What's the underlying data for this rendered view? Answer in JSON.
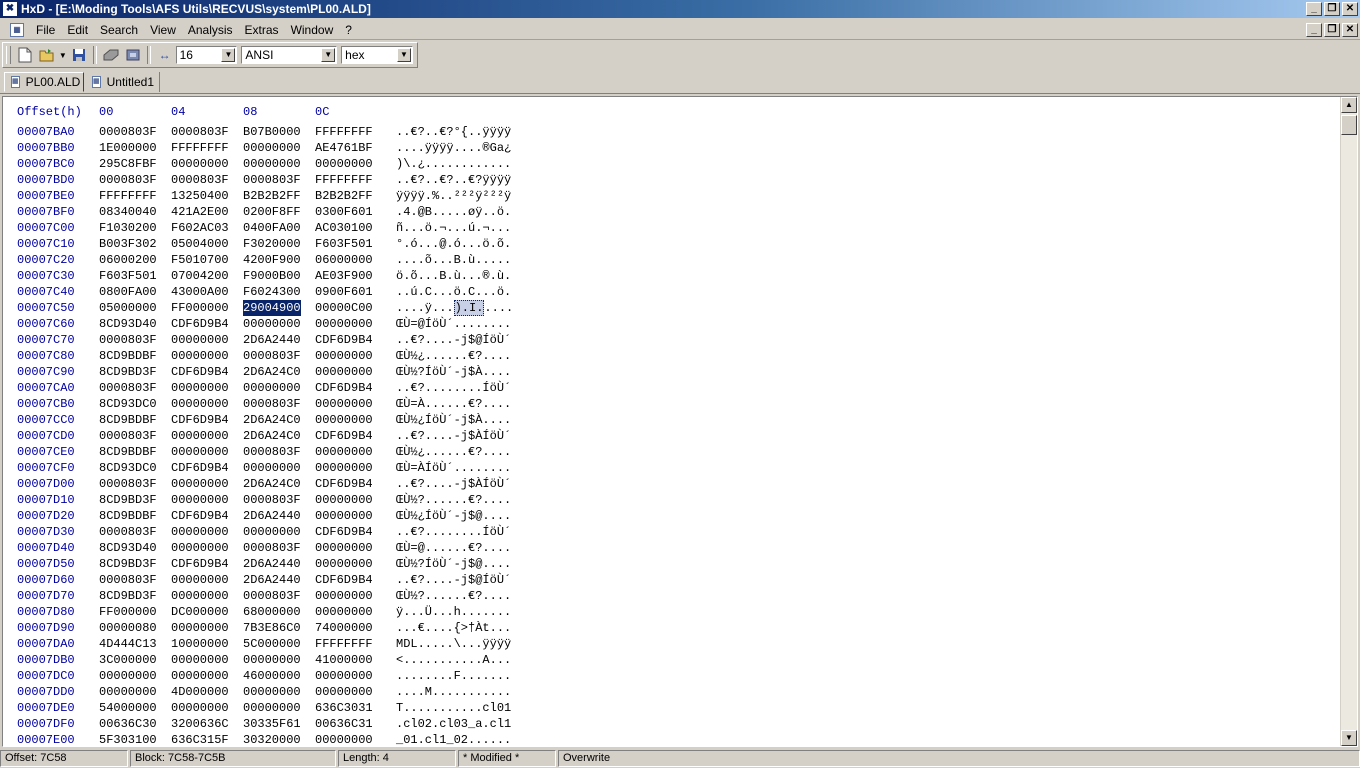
{
  "window": {
    "title": "HxD - [E:\\Moding Tools\\AFS Utils\\RECVUS\\system\\PL00.ALD]",
    "app_icon": "hxd-app-icon",
    "controls": [
      "minimize-icon",
      "restore-icon",
      "close-icon"
    ]
  },
  "menu": {
    "items": [
      "File",
      "Edit",
      "Search",
      "View",
      "Analysis",
      "Extras",
      "Window",
      "?"
    ]
  },
  "toolbar": {
    "bytes_per_row": "16",
    "charset": "ANSI",
    "offset_base": "hex",
    "icons": [
      "new-file-icon",
      "open-file-icon",
      "save-icon",
      "open-disk-icon",
      "open-ram-icon",
      "bytes-per-row-icon"
    ]
  },
  "tabs": [
    {
      "label": "PL00.ALD",
      "active": true
    },
    {
      "label": "Untitled1",
      "active": false
    }
  ],
  "hex_header": {
    "offset": "Offset(h)",
    "cols": [
      "00",
      "04",
      "08",
      "0C"
    ]
  },
  "rows": [
    {
      "o": "00007BA0",
      "h": [
        "0000803F",
        "0000803F",
        "B07B0000",
        "FFFFFFFF"
      ],
      "t": "..€?..€?°{..ÿÿÿÿ"
    },
    {
      "o": "00007BB0",
      "h": [
        "1E000000",
        "FFFFFFFF",
        "00000000",
        "AE4761BF"
      ],
      "t": "....ÿÿÿÿ....®Ga¿"
    },
    {
      "o": "00007BC0",
      "h": [
        "295C8FBF",
        "00000000",
        "00000000",
        "00000000"
      ],
      "t": ")\\.¿............"
    },
    {
      "o": "00007BD0",
      "h": [
        "0000803F",
        "0000803F",
        "0000803F",
        "FFFFFFFF"
      ],
      "t": "..€?..€?..€?ÿÿÿÿ"
    },
    {
      "o": "00007BE0",
      "h": [
        "FFFFFFFF",
        "13250400",
        "B2B2B2FF",
        "B2B2B2FF"
      ],
      "t": "ÿÿÿÿ.%..²²²ÿ²²²ÿ"
    },
    {
      "o": "00007BF0",
      "h": [
        "08340040",
        "421A2E00",
        "0200F8FF",
        "0300F601"
      ],
      "t": ".4.@B.....øÿ..ö."
    },
    {
      "o": "00007C00",
      "h": [
        "F1030200",
        "F602AC03",
        "0400FA00",
        "AC030100"
      ],
      "t": "ñ...ö.¬...ú.¬..."
    },
    {
      "o": "00007C10",
      "h": [
        "B003F302",
        "05004000",
        "F3020000",
        "F603F501"
      ],
      "t": "°.ó...@.ó...ö.õ."
    },
    {
      "o": "00007C20",
      "h": [
        "06000200",
        "F5010700",
        "4200F900",
        "06000000"
      ],
      "t": "....õ...B.ù....."
    },
    {
      "o": "00007C30",
      "h": [
        "F603F501",
        "07004200",
        "F9000B00",
        "AE03F900"
      ],
      "t": "ö.õ...B.ù...®.ù."
    },
    {
      "o": "00007C40",
      "h": [
        "0800FA00",
        "43000A00",
        "F6024300",
        "0900F601"
      ],
      "t": "..ú.C...ö.C...ö."
    },
    {
      "o": "00007C50",
      "h": [
        "05000000",
        "FF000000",
        "29004900",
        "00000C00"
      ],
      "t": "....ÿ...).I....."
    },
    {
      "o": "00007C60",
      "h": [
        "8CD93D40",
        "CDF6D9B4",
        "00000000",
        "00000000"
      ],
      "t": "ŒÙ=@ÍöÙ´........"
    },
    {
      "o": "00007C70",
      "h": [
        "0000803F",
        "00000000",
        "2D6A2440",
        "CDF6D9B4"
      ],
      "t": "..€?....-j$@ÍöÙ´"
    },
    {
      "o": "00007C80",
      "h": [
        "8CD9BDBF",
        "00000000",
        "0000803F",
        "00000000"
      ],
      "t": "ŒÙ½¿......€?...."
    },
    {
      "o": "00007C90",
      "h": [
        "8CD9BD3F",
        "CDF6D9B4",
        "2D6A24C0",
        "00000000"
      ],
      "t": "ŒÙ½?ÍöÙ´-j$À...."
    },
    {
      "o": "00007CA0",
      "h": [
        "0000803F",
        "00000000",
        "00000000",
        "CDF6D9B4"
      ],
      "t": "..€?........ÍöÙ´"
    },
    {
      "o": "00007CB0",
      "h": [
        "8CD93DC0",
        "00000000",
        "0000803F",
        "00000000"
      ],
      "t": "ŒÙ=À......€?...."
    },
    {
      "o": "00007CC0",
      "h": [
        "8CD9BDBF",
        "CDF6D9B4",
        "2D6A24C0",
        "00000000"
      ],
      "t": "ŒÙ½¿ÍöÙ´-j$À...."
    },
    {
      "o": "00007CD0",
      "h": [
        "0000803F",
        "00000000",
        "2D6A24C0",
        "CDF6D9B4"
      ],
      "t": "..€?....-j$ÀÍöÙ´"
    },
    {
      "o": "00007CE0",
      "h": [
        "8CD9BDBF",
        "00000000",
        "0000803F",
        "00000000"
      ],
      "t": "ŒÙ½¿......€?...."
    },
    {
      "o": "00007CF0",
      "h": [
        "8CD93DC0",
        "CDF6D9B4",
        "00000000",
        "00000000"
      ],
      "t": "ŒÙ=ÀÍöÙ´........"
    },
    {
      "o": "00007D00",
      "h": [
        "0000803F",
        "00000000",
        "2D6A24C0",
        "CDF6D9B4"
      ],
      "t": "..€?....-j$ÀÍöÙ´"
    },
    {
      "o": "00007D10",
      "h": [
        "8CD9BD3F",
        "00000000",
        "0000803F",
        "00000000"
      ],
      "t": "ŒÙ½?......€?...."
    },
    {
      "o": "00007D20",
      "h": [
        "8CD9BDBF",
        "CDF6D9B4",
        "2D6A2440",
        "00000000"
      ],
      "t": "ŒÙ½¿ÍöÙ´-j$@...."
    },
    {
      "o": "00007D30",
      "h": [
        "0000803F",
        "00000000",
        "00000000",
        "CDF6D9B4"
      ],
      "t": "..€?........ÍöÙ´"
    },
    {
      "o": "00007D40",
      "h": [
        "8CD93D40",
        "00000000",
        "0000803F",
        "00000000"
      ],
      "t": "ŒÙ=@......€?...."
    },
    {
      "o": "00007D50",
      "h": [
        "8CD9BD3F",
        "CDF6D9B4",
        "2D6A2440",
        "00000000"
      ],
      "t": "ŒÙ½?ÍöÙ´-j$@...."
    },
    {
      "o": "00007D60",
      "h": [
        "0000803F",
        "00000000",
        "2D6A2440",
        "CDF6D9B4"
      ],
      "t": "..€?....-j$@ÍöÙ´"
    },
    {
      "o": "00007D70",
      "h": [
        "8CD9BD3F",
        "00000000",
        "0000803F",
        "00000000"
      ],
      "t": "ŒÙ½?......€?...."
    },
    {
      "o": "00007D80",
      "h": [
        "FF000000",
        "DC000000",
        "68000000",
        "00000000"
      ],
      "t": "ÿ...Ü...h......."
    },
    {
      "o": "00007D90",
      "h": [
        "00000080",
        "00000000",
        "7B3E86C0",
        "74000000"
      ],
      "t": "...€....{>†Àt..."
    },
    {
      "o": "00007DA0",
      "h": [
        "4D444C13",
        "10000000",
        "5C000000",
        "FFFFFFFF"
      ],
      "t": "MDL.....\\...ÿÿÿÿ"
    },
    {
      "o": "00007DB0",
      "h": [
        "3C000000",
        "00000000",
        "00000000",
        "41000000"
      ],
      "t": "<...........A..."
    },
    {
      "o": "00007DC0",
      "h": [
        "00000000",
        "00000000",
        "46000000",
        "00000000"
      ],
      "t": "........F......."
    },
    {
      "o": "00007DD0",
      "h": [
        "00000000",
        "4D000000",
        "00000000",
        "00000000"
      ],
      "t": "....M..........."
    },
    {
      "o": "00007DE0",
      "h": [
        "54000000",
        "00000000",
        "00000000",
        "636C3031"
      ],
      "t": "T...........cl01"
    },
    {
      "o": "00007DF0",
      "h": [
        "00636C30",
        "3200636C",
        "30335F61",
        "00636C31"
      ],
      "t": ".cl02.cl03_a.cl1"
    },
    {
      "o": "00007E00",
      "h": [
        "5F303100",
        "636C315F",
        "30320000",
        "00000000"
      ],
      "t": "_01.cl1_02......"
    }
  ],
  "selection": {
    "row": 11,
    "col": 2
  },
  "status": {
    "offset": "Offset: 7C58",
    "block": "Block: 7C58-7C5B",
    "length": "Length: 4",
    "modified": "* Modified *",
    "mode": "Overwrite"
  },
  "colors": {
    "offset_blue": "#0000a0",
    "selection": "#0a246a",
    "title_bar": "#0a246a"
  }
}
